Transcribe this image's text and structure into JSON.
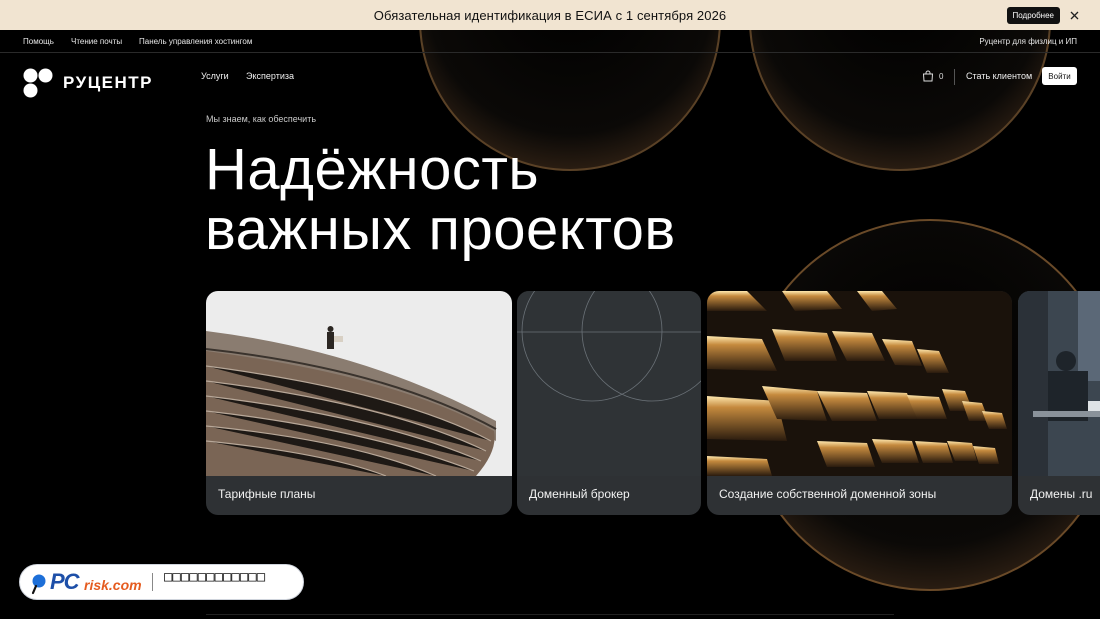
{
  "announcement": {
    "text": "Обязательная идентификация в ЕСИА с 1 сентября 2026",
    "button_label": "Подробнее"
  },
  "utility_nav": {
    "items": [
      "Помощь",
      "Чтение почты",
      "Панель управления хостингом"
    ],
    "right_link": "Руцентр для физлиц и ИП"
  },
  "header": {
    "logo_text": "РУЦЕНТР",
    "nav": [
      "Услуги",
      "Экспертиза"
    ],
    "cart_count": "0",
    "become_client": "Стать клиентом",
    "login": "Войти"
  },
  "hero": {
    "eyebrow": "Мы знаем, как обеспечить",
    "title_line1": "Надёжность",
    "title_line2": "важных проектов"
  },
  "cards": [
    {
      "label": "Тарифные планы"
    },
    {
      "label": "Доменный брокер"
    },
    {
      "label": "Создание собственной доменной зоны"
    },
    {
      "label": "Домены .ru"
    }
  ],
  "watermark": {
    "brand_pc": "PC",
    "brand_rest": "risk.com",
    "tag": "□□□□□□□□□□□□"
  },
  "colors": {
    "announce_bg": "#f1e4d1",
    "page_bg": "#000000",
    "card_bg": "#2e3134",
    "accent_warm": "#e9b36a"
  }
}
